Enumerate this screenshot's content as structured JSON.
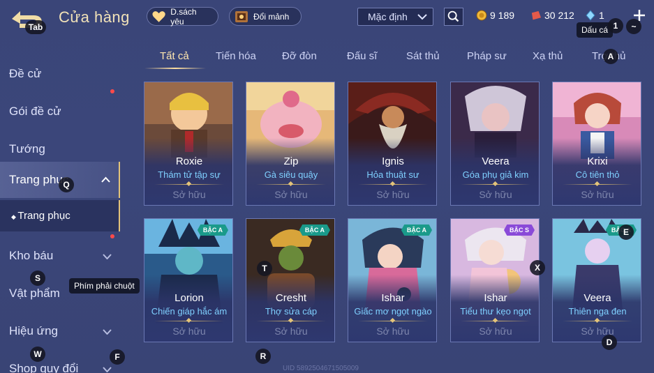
{
  "header": {
    "back_key": "Tab",
    "title": "Cửa hàng",
    "wishlist_label": "D.sách yêu",
    "exchange_label": "Đổi mảnh",
    "sort_value": "Mặc định",
    "gold": "9 189",
    "vouchers": "30 212",
    "diamonds": "1",
    "tooltip": "Dấu cá",
    "key_1": "1",
    "key_tilde": "~"
  },
  "sidebar": {
    "items": [
      {
        "label": "Đề cử"
      },
      {
        "label": "Gói đề cử"
      },
      {
        "label": "Tướng"
      },
      {
        "label": "Trang phục"
      },
      {
        "label": "Trang phục"
      },
      {
        "label": "Kho báu"
      },
      {
        "label": "Vật phẩm"
      },
      {
        "label": "Hiệu ứng"
      },
      {
        "label": "Shop quy đổi"
      }
    ],
    "tooltip": "Phím phải chuột"
  },
  "tabs": [
    "Tất cả",
    "Tiến hóa",
    "Đỡ đòn",
    "Đấu sĩ",
    "Sát thủ",
    "Pháp sư",
    "Xạ thủ",
    "Trợ thủ"
  ],
  "cards": [
    {
      "hero": "Roxie",
      "skin": "Thám tử tập sự",
      "status": "Sở hữu",
      "badge": ""
    },
    {
      "hero": "Zip",
      "skin": "Gà siêu quậy",
      "status": "Sở hữu",
      "badge": ""
    },
    {
      "hero": "Ignis",
      "skin": "Hỏa thuật sư",
      "status": "Sở hữu",
      "badge": ""
    },
    {
      "hero": "Veera",
      "skin": "Góa phụ giả kim",
      "status": "Sở hữu",
      "badge": ""
    },
    {
      "hero": "Krixi",
      "skin": "Cô tiên thỏ",
      "status": "Sở hữu",
      "badge": ""
    },
    {
      "hero": "Lorion",
      "skin": "Chiến giáp hắc ám",
      "status": "Sở hữu",
      "badge": "BẬC A"
    },
    {
      "hero": "Cresht",
      "skin": "Thợ sửa cáp",
      "status": "Sở hữu",
      "badge": "BẬC A"
    },
    {
      "hero": "Ishar",
      "skin": "Giấc mơ ngọt ngào",
      "status": "Sở hữu",
      "badge": "BẬC A"
    },
    {
      "hero": "Ishar",
      "skin": "Tiểu thư kẹo ngọt",
      "status": "Sở hữu",
      "badge": "BẬC S"
    },
    {
      "hero": "Veera",
      "skin": "Thiên nga đen",
      "status": "Sở hữu",
      "badge": "BẬC A"
    }
  ],
  "key_hints": {
    "q": "Q",
    "s": "S",
    "w": "W",
    "f": "F",
    "t": "T",
    "r": "R",
    "x": "X",
    "a": "A",
    "e": "E",
    "d": "D"
  },
  "uid": "UID 5892504671505009"
}
